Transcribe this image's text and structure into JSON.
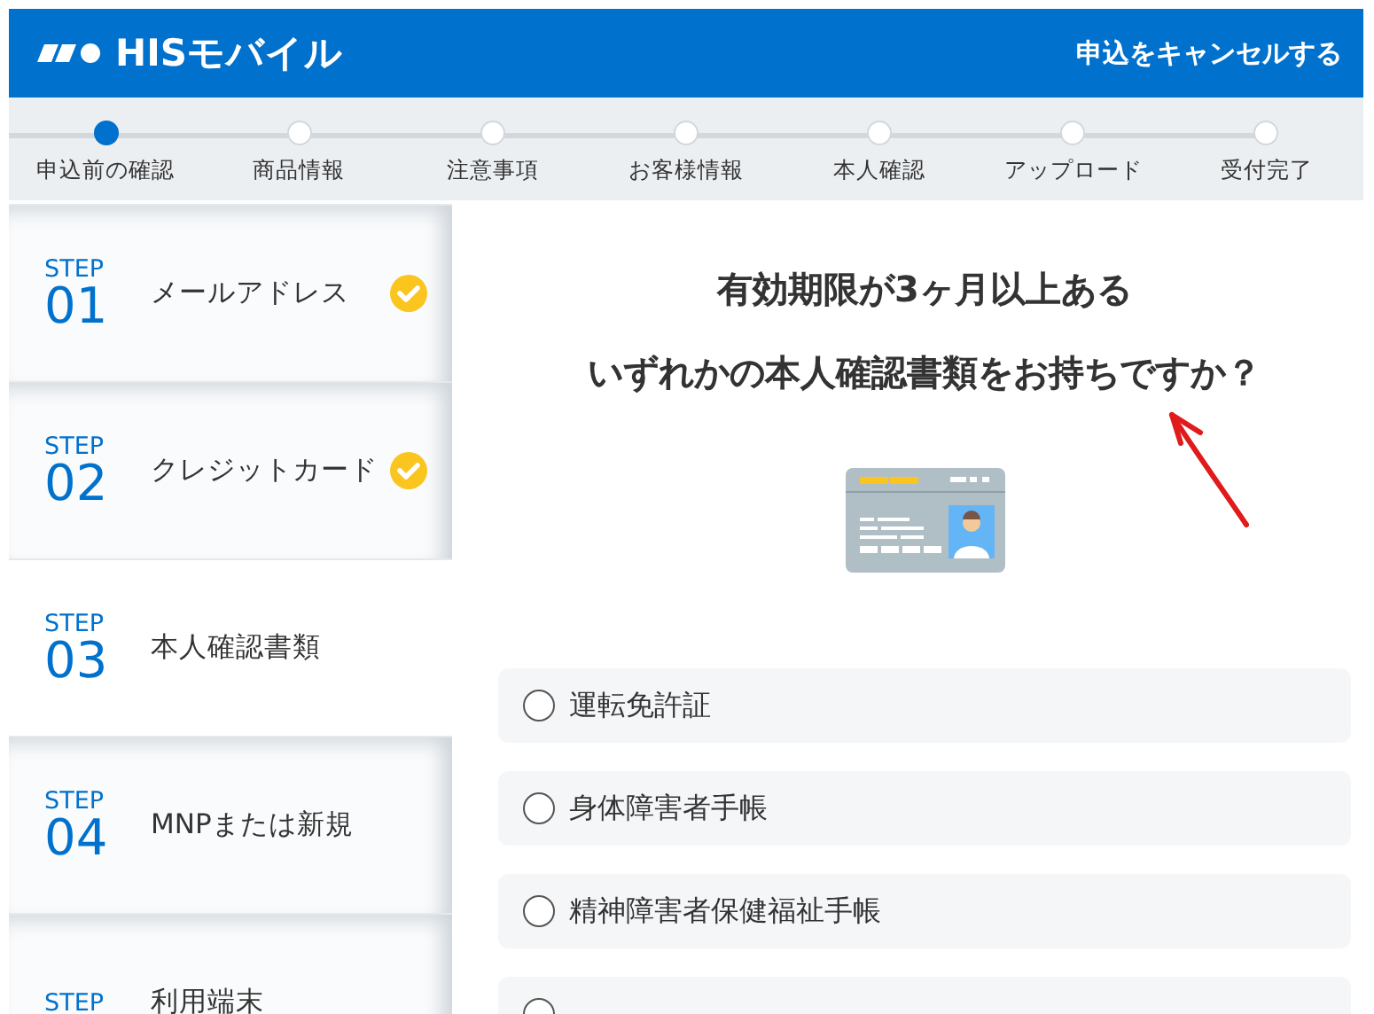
{
  "header": {
    "logo": "HISモバイル",
    "cancel_link": "申込をキャンセルする"
  },
  "progress": [
    {
      "label": "申込前の確認",
      "selected": true
    },
    {
      "label": "商品情報",
      "selected": false
    },
    {
      "label": "注意事項",
      "selected": false
    },
    {
      "label": "お客様情報",
      "selected": false
    },
    {
      "label": "本人確認",
      "selected": false
    },
    {
      "label": "アップロード",
      "selected": false
    },
    {
      "label": "受付完了",
      "selected": false
    }
  ],
  "sidebar": {
    "items": [
      {
        "step_label": "STEP",
        "number": "01",
        "label": "メールアドレス",
        "completed": true,
        "selected": false
      },
      {
        "step_label": "STEP",
        "number": "02",
        "label": "クレジットカード",
        "completed": true,
        "selected": false
      },
      {
        "step_label": "STEP",
        "number": "03",
        "label": "本人確認書類",
        "completed": false,
        "selected": true
      },
      {
        "step_label": "STEP",
        "number": "04",
        "label": "MNPまたは新規",
        "completed": false,
        "selected": false
      },
      {
        "step_label": "STEP",
        "label": "利用端末",
        "completed": false,
        "selected": false
      }
    ]
  },
  "question": {
    "lines": [
      "有効期限が3ヶ月以上ある",
      "いずれかの本人確認書類をお持ちですか？"
    ],
    "options": [
      {
        "label": "運転免許証",
        "selected": false
      },
      {
        "label": "身体障害者手帳",
        "selected": false
      },
      {
        "label": "精神障害者保健福祉手帳",
        "selected": false
      },
      {
        "selected": false
      }
    ]
  }
}
